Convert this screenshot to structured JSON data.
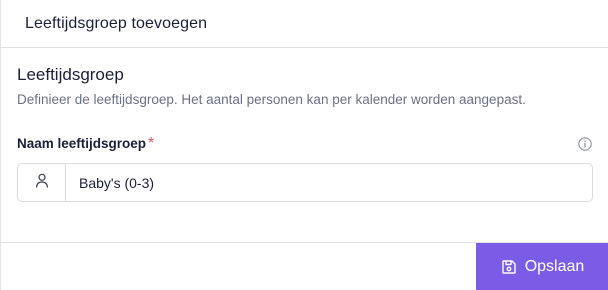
{
  "dialog": {
    "title": "Leeftijdsgroep toevoegen"
  },
  "section": {
    "title": "Leeftijdsgroep",
    "description": "Definieer de leeftijdsgroep. Het aantal personen kan per kalender worden aangepast."
  },
  "field": {
    "label": "Naam leeftijdsgroep",
    "required_mark": "*",
    "value": "Baby's (0-3)",
    "prefix_icon": "user-icon",
    "help_icon": "info-icon"
  },
  "footer": {
    "save_label": "Opslaan",
    "save_icon": "save-icon"
  },
  "colors": {
    "accent": "#7b5ce6",
    "required": "#e05667",
    "text": "#1b1f3b",
    "muted": "#6b7088"
  }
}
